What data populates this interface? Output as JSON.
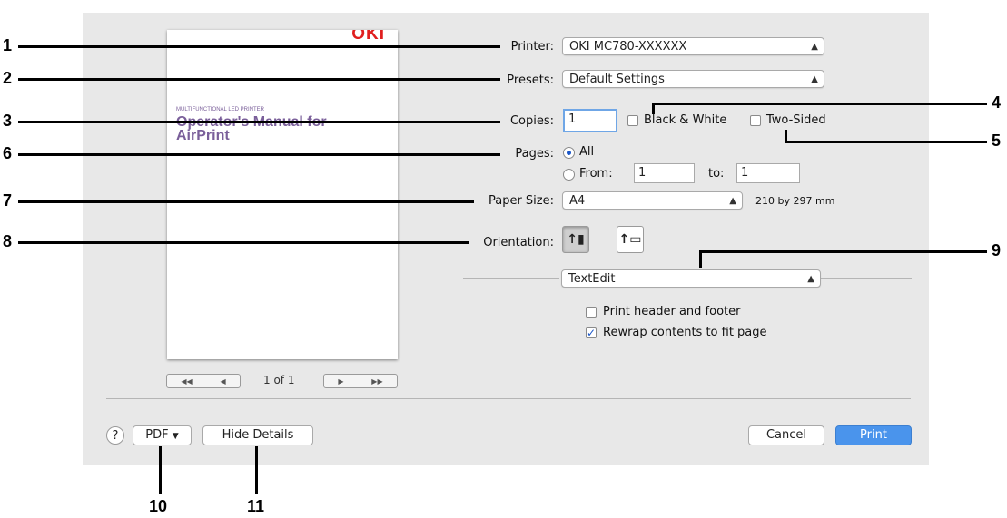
{
  "preview": {
    "logo": "OKI",
    "subtitle": "MULTIFUNCTIONAL LED PRINTER",
    "title_line1": "Operator's Manual for",
    "title_line2": "AirPrint",
    "page_indicator": "1 of 1"
  },
  "form": {
    "printer_label": "Printer:",
    "printer_value": "OKI MC780-XXXXXX",
    "presets_label": "Presets:",
    "presets_value": "Default Settings",
    "copies_label": "Copies:",
    "copies_value": "1",
    "black_white_label": "Black & White",
    "two_sided_label": "Two-Sided",
    "pages_label": "Pages:",
    "pages_all_label": "All",
    "pages_from_label": "From:",
    "pages_from_value": "1",
    "pages_to_label": "to:",
    "pages_to_value": "1",
    "paper_size_label": "Paper Size:",
    "paper_size_value": "A4",
    "paper_size_dims": "210 by 297 mm",
    "orientation_label": "Orientation:",
    "app_menu_value": "TextEdit",
    "header_footer_label": "Print header and footer",
    "rewrap_label": "Rewrap contents to fit page"
  },
  "footer": {
    "help_label": "?",
    "pdf_label": "PDF",
    "hide_details_label": "Hide Details",
    "cancel_label": "Cancel",
    "print_label": "Print"
  },
  "callouts": [
    "1",
    "2",
    "3",
    "4",
    "5",
    "6",
    "7",
    "8",
    "9",
    "10",
    "11"
  ]
}
